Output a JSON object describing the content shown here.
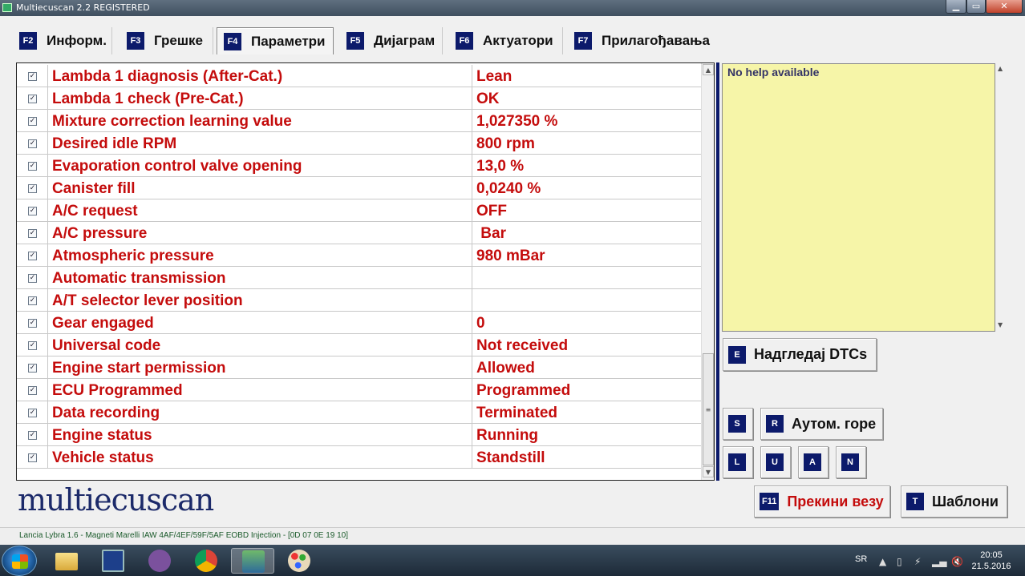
{
  "window": {
    "title": "Multiecuscan 2.2 REGISTERED",
    "min_label": "▁",
    "max_label": "▭",
    "close_label": "✕"
  },
  "tabs": [
    {
      "key": "F2",
      "label": "Информ."
    },
    {
      "key": "F3",
      "label": "Грешке"
    },
    {
      "key": "F4",
      "label": "Параметри",
      "active": true
    },
    {
      "key": "F5",
      "label": "Дијаграм"
    },
    {
      "key": "F6",
      "label": "Актуатори"
    },
    {
      "key": "F7",
      "label": "Прилагођавања"
    }
  ],
  "params": [
    {
      "name": "Lambda 1 diagnosis (After-Cat.)",
      "value": "Lean",
      "checked": true
    },
    {
      "name": "Lambda 1 check (Pre-Cat.)",
      "value": "OK",
      "checked": true
    },
    {
      "name": "Mixture correction learning value",
      "value": "1,027350 %",
      "checked": true
    },
    {
      "name": "Desired idle RPM",
      "value": "800 rpm",
      "checked": true
    },
    {
      "name": "Evaporation control valve opening",
      "value": "13,0 %",
      "checked": true
    },
    {
      "name": "Canister fill",
      "value": "0,0240 %",
      "checked": true
    },
    {
      "name": "A/C request",
      "value": "OFF",
      "checked": true
    },
    {
      "name": "A/C pressure",
      "value": " Bar",
      "checked": true
    },
    {
      "name": "Atmospheric pressure",
      "value": "980 mBar",
      "checked": true
    },
    {
      "name": "Automatic transmission",
      "value": "",
      "checked": true
    },
    {
      "name": "A/T selector lever position",
      "value": "",
      "checked": true
    },
    {
      "name": "Gear engaged",
      "value": "0",
      "checked": true
    },
    {
      "name": "Universal code",
      "value": "Not received",
      "checked": true
    },
    {
      "name": "Engine start permission",
      "value": "Allowed",
      "checked": true
    },
    {
      "name": "ECU Programmed",
      "value": "Programmed",
      "checked": true
    },
    {
      "name": "Data recording",
      "value": "Terminated",
      "checked": true
    },
    {
      "name": "Engine status",
      "value": "Running",
      "checked": true
    },
    {
      "name": "Vehicle status",
      "value": "Standstill",
      "checked": true
    }
  ],
  "checkmark": "✓",
  "scroll": {
    "up": "▲",
    "down": "▼",
    "grip": "≡"
  },
  "help": {
    "text": "No help available"
  },
  "buttons": {
    "dtc": {
      "key": "E",
      "label": "Надгледај DTCs"
    },
    "s": {
      "key": "S"
    },
    "auto": {
      "key": "R",
      "label": "Аутом. горе"
    },
    "l": {
      "key": "L"
    },
    "u": {
      "key": "U"
    },
    "a": {
      "key": "A"
    },
    "n": {
      "key": "N"
    },
    "disconnect": {
      "key": "F11",
      "label": "Прекини везу"
    },
    "templates": {
      "key": "T",
      "label": "Шаблони"
    }
  },
  "brand": "multiecuscan",
  "status": "Lancia Lybra 1.6 - Magneti Marelli IAW 4AF/4EF/59F/5AF EOBD Injection - [0D 07 0E 19 10]",
  "taskbar": {
    "apps": [
      "file-explorer",
      "save-app",
      "viber",
      "chrome",
      "multiecuscan",
      "paint"
    ],
    "lang": "SR",
    "time": "20:05",
    "date": "21.5.2016"
  },
  "colors": {
    "accent": "#0c1a6b",
    "value_red": "#c40c0c",
    "help_bg": "#f6f5a8"
  }
}
